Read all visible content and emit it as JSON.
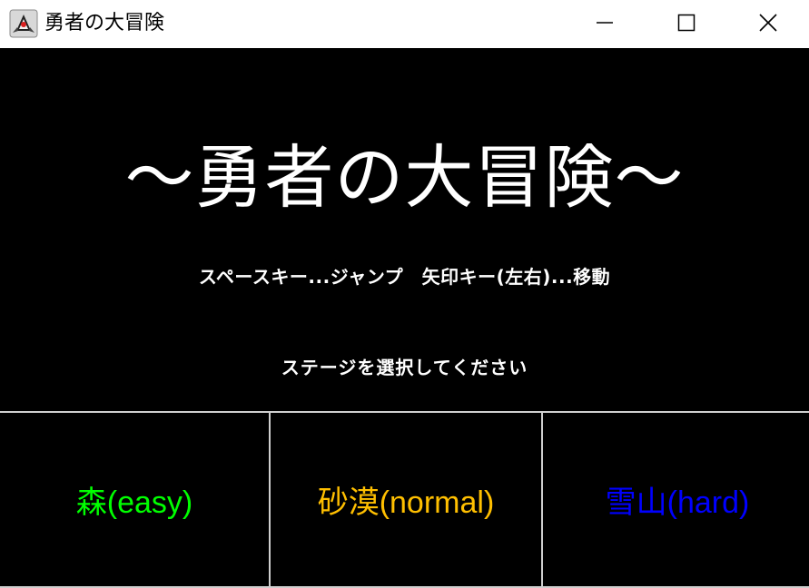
{
  "window": {
    "title": "勇者の大冒険",
    "icon": "java-duke-icon",
    "controls": [
      "minimize-icon",
      "maximize-icon",
      "close-icon"
    ]
  },
  "game": {
    "title": "～勇者の大冒険～",
    "controls_text": "スペースキー...ジャンプ　矢印キー(左右)...移動",
    "prompt": "ステージを選択してください"
  },
  "stages": [
    {
      "label": "森(easy)",
      "color": "#00ff00"
    },
    {
      "label": "砂漠(normal)",
      "color": "#ffbf00"
    },
    {
      "label": "雪山(hard)",
      "color": "#0000ff"
    }
  ],
  "colors": {
    "background": "#000000",
    "text": "#ffffff",
    "button_border": "#cfcfcf",
    "titlebar": "#ffffff"
  }
}
